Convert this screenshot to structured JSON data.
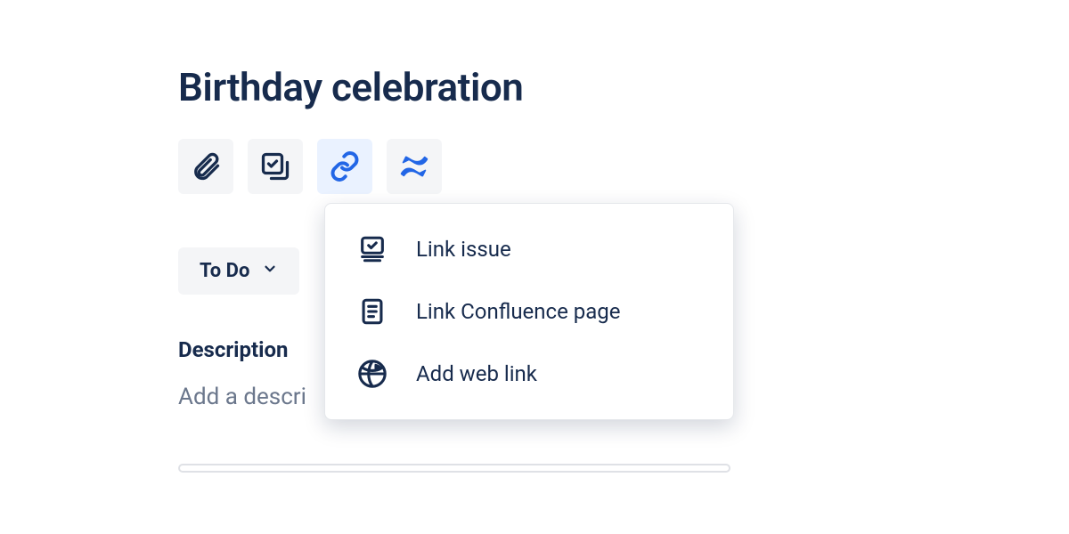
{
  "title": "Birthday celebration",
  "toolbar": {
    "attach": "attach",
    "checklist": "checklist",
    "link": "link",
    "confluence": "confluence"
  },
  "status": {
    "label": "To Do"
  },
  "description": {
    "label": "Description",
    "placeholder": "Add a descri"
  },
  "link_menu": {
    "items": [
      {
        "label": "Link issue"
      },
      {
        "label": "Link Confluence page"
      },
      {
        "label": "Add web link"
      }
    ]
  }
}
